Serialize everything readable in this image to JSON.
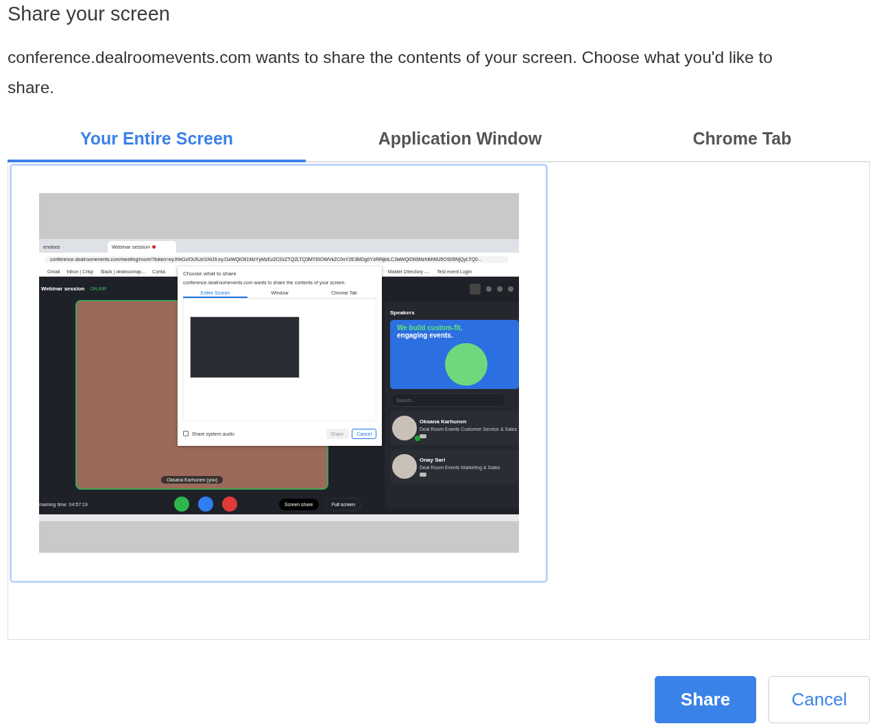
{
  "title": "Share your screen",
  "message": "conference.dealroomevents.com wants to share the contents of your screen. Choose what you'd like to share.",
  "tabs": [
    {
      "label": "Your Entire Screen",
      "selected": true
    },
    {
      "label": "Application Window",
      "selected": false
    },
    {
      "label": "Chrome Tab",
      "selected": false
    }
  ],
  "preview": {
    "selected": true,
    "browser_tabs": [
      {
        "label": "endees",
        "selected": false
      },
      {
        "label": "Webinar session",
        "selected": true
      }
    ],
    "url": "conference.dealroomevents.com/meeting/room/?token=eyJhbGciOiJIUzI1NiJ9.eyJ1aWQiOiI1MzYyMzEzZC0zZTQ2LTQ3MTEtOWVkZC0xY2E3MDg0YzRiNjkiLCJlaWQiOiI0MzhiMWU5OS05NjQyLTQ0...",
    "bookmarks": [
      "Gmail",
      "Inbox | Crisp",
      "Slack | dealroomap...",
      "Conta",
      "Master Directory -...",
      "Test event Login"
    ],
    "session_title": "Webinar session",
    "live_label": "ON AIR",
    "video_name": "Oksana Karhunen (you)",
    "remaining_time": "maining time: 04:57:19",
    "screen_share": "Screen share",
    "full_screen": "Full screen",
    "dialog": {
      "title": "Choose what to share",
      "message": "conference.dealroomevents.com wants to share the contents of your screen.",
      "tabs": [
        {
          "label": "Entire Screen",
          "selected": true
        },
        {
          "label": "Window",
          "selected": false
        },
        {
          "label": "Chrome Tab",
          "selected": false
        }
      ],
      "audio_label": "Share system audio",
      "audio_checked": false,
      "buttons": [
        {
          "label": "Share",
          "kind": "disabled"
        },
        {
          "label": "Cancel",
          "kind": "outline"
        }
      ]
    },
    "speakers_title": "Speakers",
    "banner": {
      "headline": "We build custom-fit,",
      "subline": "engaging events."
    },
    "search_placeholder": "Search...",
    "speakers": [
      {
        "name": "Oksana Karhunen",
        "role": "Deal Room Events Customer Service & Sales",
        "online": true
      },
      {
        "name": "Onay Sari",
        "role": "Deal Room Events Marketing & Sales",
        "online": false
      }
    ]
  },
  "buttons": [
    {
      "label": "Share",
      "kind": "primary"
    },
    {
      "label": "Cancel",
      "kind": "secondary"
    }
  ]
}
